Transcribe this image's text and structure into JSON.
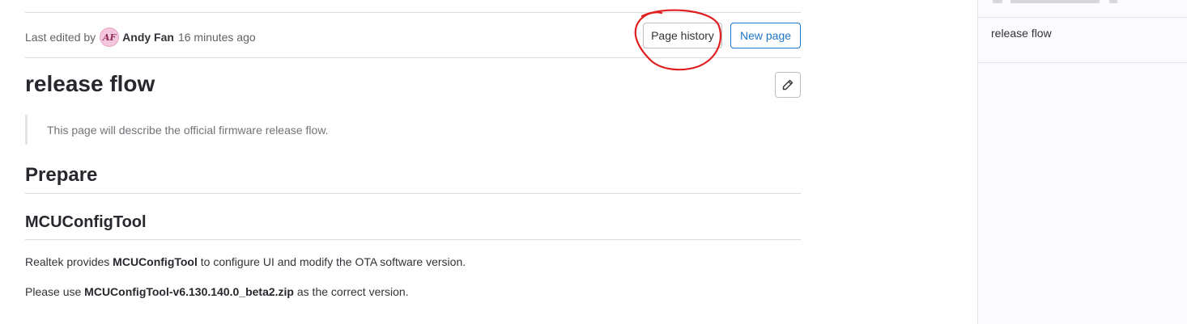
{
  "meta": {
    "last_edited_label": "Last edited by",
    "avatar_initials": "AF",
    "author": "Andy Fan",
    "time_ago": "16 minutes ago"
  },
  "actions": {
    "page_history": "Page history",
    "new_page": "New page"
  },
  "page": {
    "title": "release flow",
    "description": "This page will describe the official firmware release flow.",
    "heading_1": "Prepare",
    "heading_2": "MCUConfigTool",
    "para1": {
      "before": "Realtek provides ",
      "bold": "MCUConfigTool",
      "after": " to configure UI and modify the OTA software version."
    },
    "para2": {
      "before": "Please use ",
      "bold": "MCUConfigTool-v6.130.140.0_beta2.zip",
      "after": " as the correct version."
    }
  },
  "sidebar": {
    "items": [
      {
        "label": "release flow"
      }
    ]
  },
  "colors": {
    "annotation": "#e02020",
    "primary": "#1f75cb",
    "border": "#dcdcde"
  },
  "icons": {
    "edit": "pencil-icon"
  }
}
